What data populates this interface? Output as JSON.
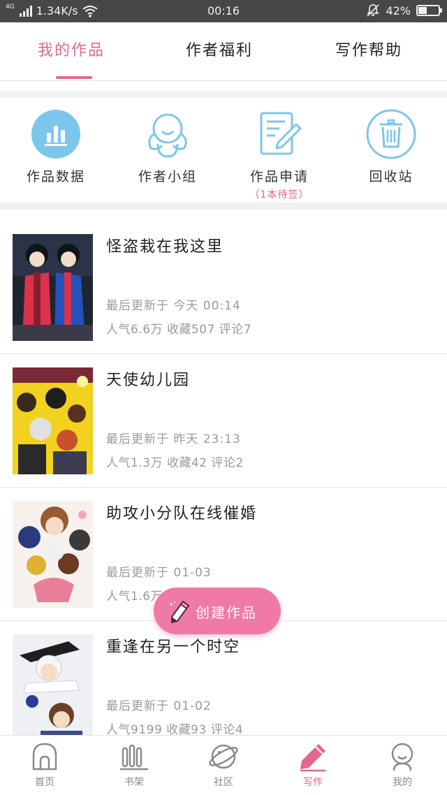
{
  "status_bar": {
    "network": "4G",
    "speed": "1.34K/s",
    "time": "00:16",
    "battery": "42%",
    "battery_level": 0.42
  },
  "tabs": [
    {
      "label": "我的作品",
      "active": true
    },
    {
      "label": "作者福利",
      "active": false
    },
    {
      "label": "写作帮助",
      "active": false
    }
  ],
  "actions": [
    {
      "label": "作品数据",
      "icon": "bar-chart-icon"
    },
    {
      "label": "作者小组",
      "icon": "group-icon"
    },
    {
      "label": "作品申请",
      "icon": "edit-doc-icon",
      "sub": "（1本待签）"
    },
    {
      "label": "回收站",
      "icon": "trash-icon"
    }
  ],
  "works": [
    {
      "title": "怪盗栽在我这里",
      "updated": "最后更新于 今天 00:14",
      "stats": "人气6.6万 收藏507 评论7"
    },
    {
      "title": "天使幼儿园",
      "updated": "最后更新于 昨天 23:13",
      "stats": "人气1.3万 收藏42 评论2"
    },
    {
      "title": "助攻小分队在线催婚",
      "updated": "最后更新于 01-03",
      "stats": "人气1.6万"
    },
    {
      "title": "重逢在另一个时空",
      "updated": "最后更新于 01-02",
      "stats": "人气9199 收藏93 评论4"
    }
  ],
  "fab": {
    "label": "创建作品",
    "icon": "pencil-icon"
  },
  "bottom_nav": [
    {
      "label": "首页",
      "icon": "home-icon",
      "active": false
    },
    {
      "label": "书架",
      "icon": "bookshelf-icon",
      "active": false
    },
    {
      "label": "社区",
      "icon": "planet-icon",
      "active": false
    },
    {
      "label": "写作",
      "icon": "pen-icon",
      "active": true
    },
    {
      "label": "我的",
      "icon": "profile-icon",
      "active": false
    }
  ],
  "colors": {
    "accent": "#e0688e",
    "fab": "#f07aa6",
    "icon_blue": "#7cc6ec",
    "status_bar": "#474747"
  }
}
